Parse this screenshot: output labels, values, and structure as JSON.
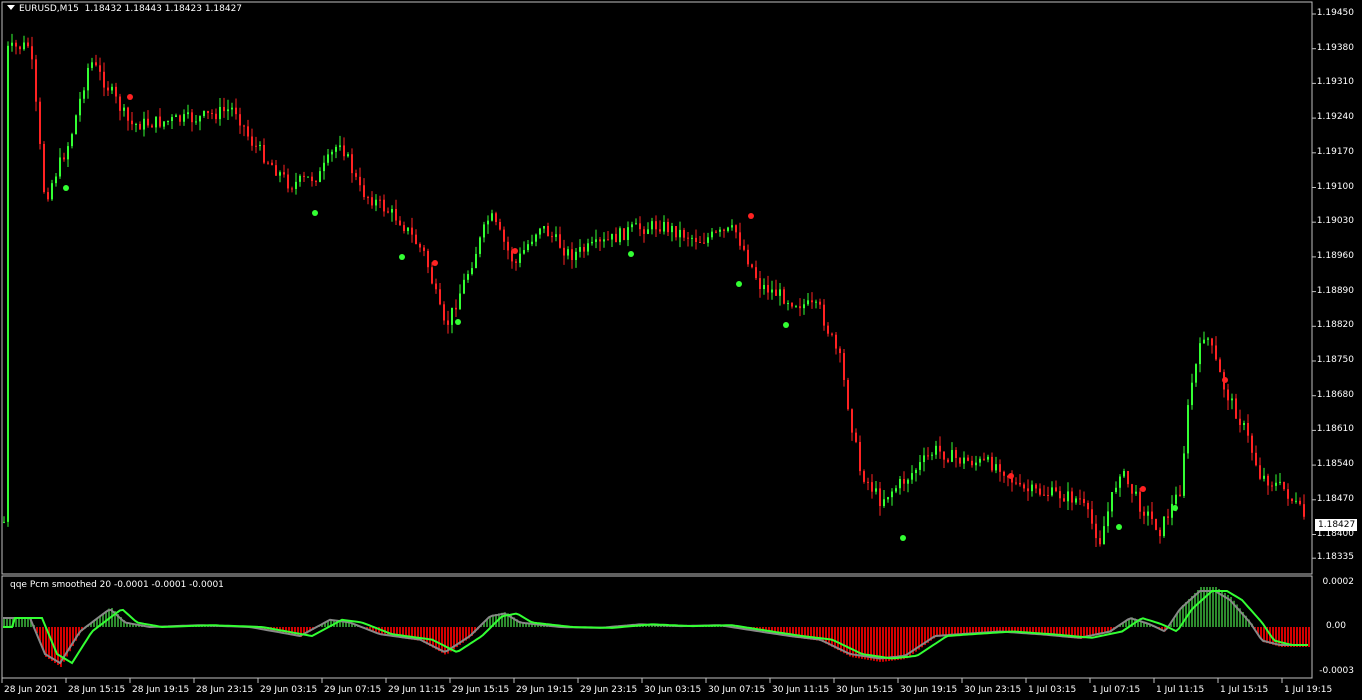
{
  "window": {
    "symbol_label": "EURUSD,M15",
    "ohlc": "1.18432 1.18443 1.18423 1.18427"
  },
  "indicator": {
    "label": "qqe Pcm smoothed 20 -0.0001 -0.0001 -0.0001",
    "axis": [
      "0.0002",
      "0.00",
      "-0.0003"
    ]
  },
  "price_axis": [
    "1.19450",
    "1.19380",
    "1.19310",
    "1.19240",
    "1.19170",
    "1.19100",
    "1.19030",
    "1.18960",
    "1.18890",
    "1.18820",
    "1.18750",
    "1.18680",
    "1.18610",
    "1.18540",
    "1.18470",
    "1.18400",
    "1.18335"
  ],
  "current_price": "1.18427",
  "time_axis": [
    "28 Jun 2021",
    "28 Jun 15:15",
    "28 Jun 19:15",
    "28 Jun 23:15",
    "29 Jun 03:15",
    "29 Jun 07:15",
    "29 Jun 11:15",
    "29 Jun 15:15",
    "29 Jun 19:15",
    "29 Jun 23:15",
    "30 Jun 03:15",
    "30 Jun 07:15",
    "30 Jun 11:15",
    "30 Jun 15:15",
    "30 Jun 19:15",
    "30 Jun 23:15",
    "1 Jul 03:15",
    "1 Jul 07:15",
    "1 Jul 11:15",
    "1 Jul 15:15",
    "1 Jul 19:15"
  ],
  "colors": {
    "bull": "#33ff33",
    "bear": "#ff2222",
    "qqe_line": "#33ff33",
    "qqe_signal": "#888888",
    "hist_up": "#2e8b2e",
    "hist_down": "#d40000"
  },
  "chart_data": {
    "type": "line",
    "title": "EURUSD,M15",
    "ylim": [
      1.18335,
      1.1945
    ],
    "x": [
      "28 Jun 2021",
      "28 Jun 15:15",
      "28 Jun 19:15",
      "28 Jun 23:15",
      "29 Jun 03:15",
      "29 Jun 07:15",
      "29 Jun 11:15",
      "29 Jun 15:15",
      "29 Jun 19:15",
      "29 Jun 23:15",
      "30 Jun 03:15",
      "30 Jun 07:15",
      "30 Jun 11:15",
      "30 Jun 15:15",
      "30 Jun 19:15",
      "30 Jun 23:15",
      "1 Jul 03:15",
      "1 Jul 07:15",
      "1 Jul 11:15",
      "1 Jul 15:15",
      "1 Jul 19:15"
    ],
    "series": [
      {
        "name": "EURUSD,M15",
        "values": [
          1.1939,
          1.1925,
          1.1923,
          1.1926,
          1.1915,
          1.192,
          1.1893,
          1.1903,
          1.1897,
          1.1899,
          1.19,
          1.1898,
          1.1886,
          1.1852,
          1.185,
          1.1853,
          1.1848,
          1.1843,
          1.188,
          1.1866,
          1.18427
        ]
      }
    ]
  }
}
